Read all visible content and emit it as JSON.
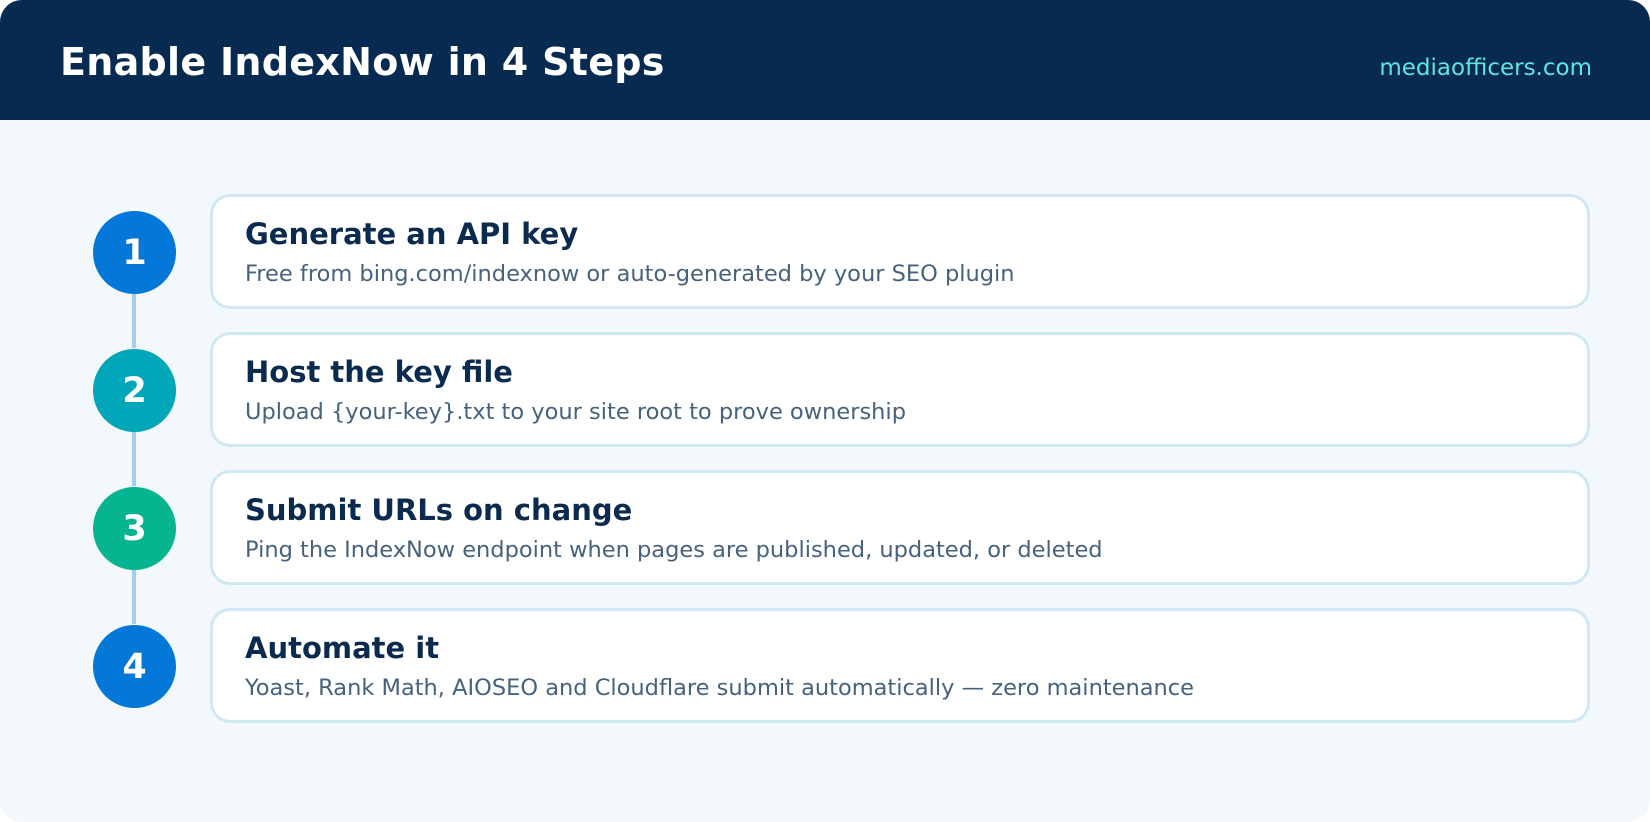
{
  "header": {
    "title": "Enable IndexNow in 4 Steps",
    "domain": "mediaofficers.com"
  },
  "steps": [
    {
      "number": "1",
      "title": "Generate an API key",
      "description": "Free from bing.com/indexnow or auto-generated by your SEO plugin",
      "color": "#0478d8"
    },
    {
      "number": "2",
      "title": "Host the key file",
      "description": "Upload {your-key}.txt to your site root to prove ownership",
      "color": "#01a6b9"
    },
    {
      "number": "3",
      "title": "Submit URLs on change",
      "description": "Ping the IndexNow endpoint when pages are published, updated, or deleted",
      "color": "#06b48f"
    },
    {
      "number": "4",
      "title": "Automate it",
      "description": "Yoast, Rank Math, AIOSEO and Cloudflare submit automatically — zero maintenance",
      "color": "#0478d8"
    }
  ],
  "colors": {
    "header_background": "#072a50",
    "domain_text": "#5ee6e0",
    "page_background": "#f3f8fc",
    "connector": "#a3cfe8"
  }
}
